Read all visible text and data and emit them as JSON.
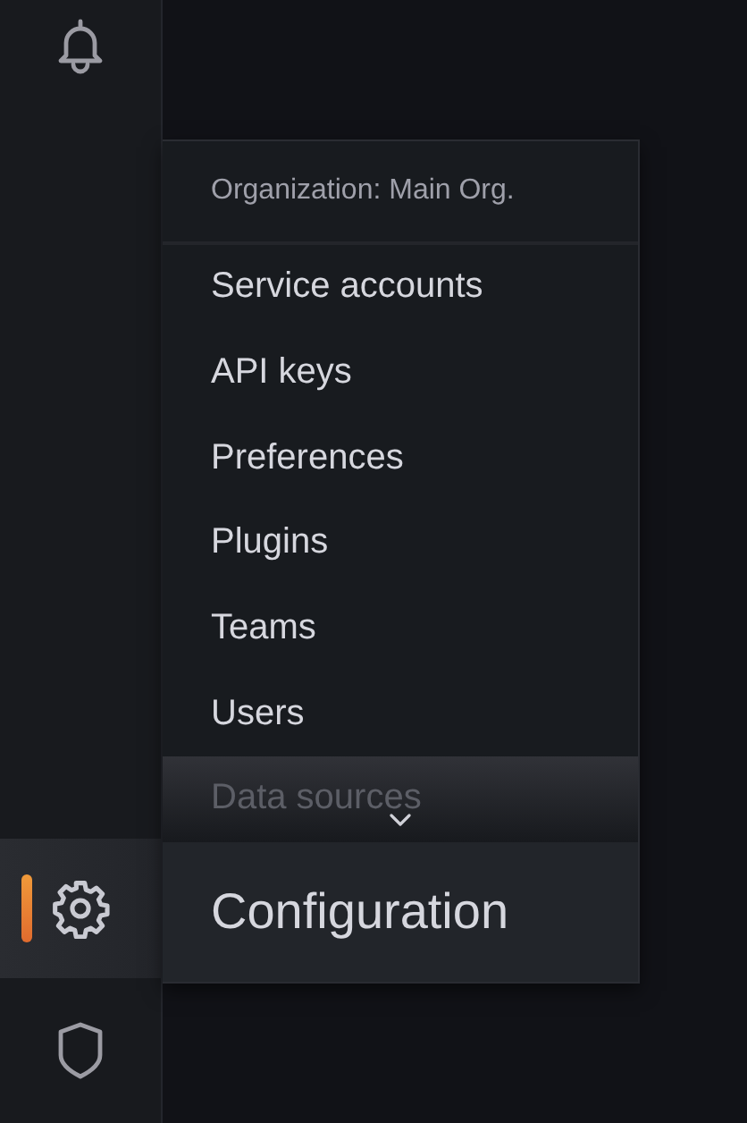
{
  "sidebar": {
    "items": [
      {
        "kind": "bell",
        "selected": false
      },
      {
        "kind": "gear",
        "selected": true
      },
      {
        "kind": "shield",
        "selected": false
      }
    ]
  },
  "menu": {
    "header": "Organization: Main Org.",
    "items": [
      "Service accounts",
      "API keys",
      "Preferences",
      "Plugins",
      "Teams",
      "Users",
      "Data sources"
    ],
    "more_below": true,
    "title": "Configuration"
  }
}
